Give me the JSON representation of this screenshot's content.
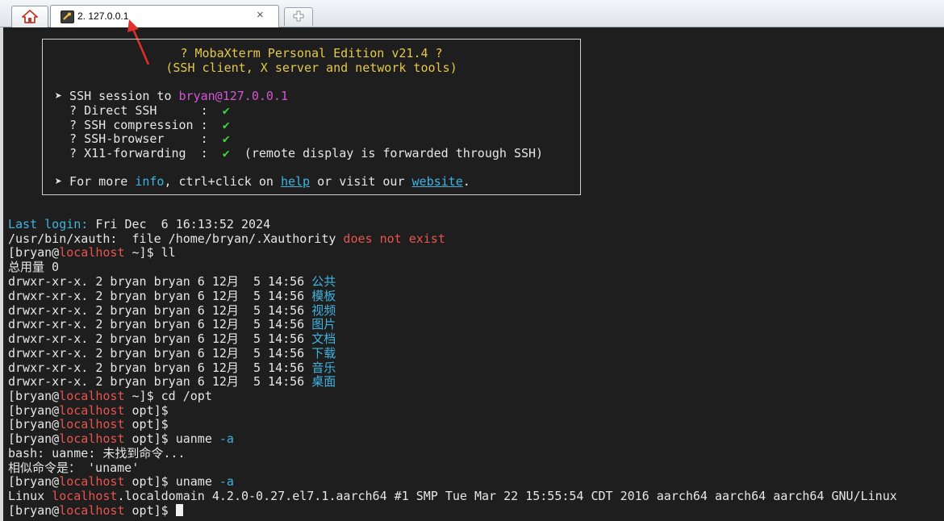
{
  "tabs": {
    "session_label": "2. 127.0.0.1",
    "close_symbol": "×"
  },
  "banner": {
    "title": "? MobaXterm Personal Edition v21.4 ?",
    "subtitle": "(SSH client, X server and network tools)",
    "ssh_session_prefix": "➤ SSH session to ",
    "ssh_target": "bryan@127.0.0.1",
    "opt1_label": "  ? Direct SSH      :  ",
    "opt2_label": "  ? SSH compression :  ",
    "opt3_label": "  ? SSH-browser     :  ",
    "opt4_label": "  ? X11-forwarding  :  ",
    "check": "✔",
    "opt4_note": "  (remote display is forwarded through SSH)",
    "more_prefix": "➤ For more ",
    "more_info": "info",
    "more_mid": ", ctrl+click on ",
    "more_help": "help",
    "more_mid2": " or visit our ",
    "more_website": "website",
    "more_end": "."
  },
  "terminal": {
    "last_login_label": "Last login:",
    "last_login_value": " Fri Dec  6 16:13:52 2024",
    "xauth_prefix": "/usr/bin/xauth:  file /home/bryan/.Xauthority ",
    "xauth_error": "does not exist",
    "user": "[bryan@",
    "host": "localhost",
    "home_dir": " ~]$ ",
    "opt_dir": " opt]$",
    "cmd_ll": "ll",
    "total": "总用量 0",
    "dir_prefix": "drwxr-xr-x. 2 bryan bryan 6 12月  5 14:56 ",
    "dirs": [
      "公共",
      "模板",
      "视频",
      "图片",
      "文档",
      "下载",
      "音乐",
      "桌面"
    ],
    "cmd_cd": "cd /opt",
    "cmd_uanme": " uanme ",
    "flag_a": "-a",
    "bash_error": "bash: uanme: 未找到命令...",
    "similar": "相似命令是： 'uname'",
    "cmd_uname": " uname ",
    "linux_prefix": "Linux ",
    "linux_host": "localhost",
    "linux_rest": ".localdomain 4.2.0-0.27.el7.1.aarch64 #1 SMP Tue Mar 22 15:55:54 CDT 2016 aarch64 aarch64 aarch64 GNU/Linux"
  }
}
